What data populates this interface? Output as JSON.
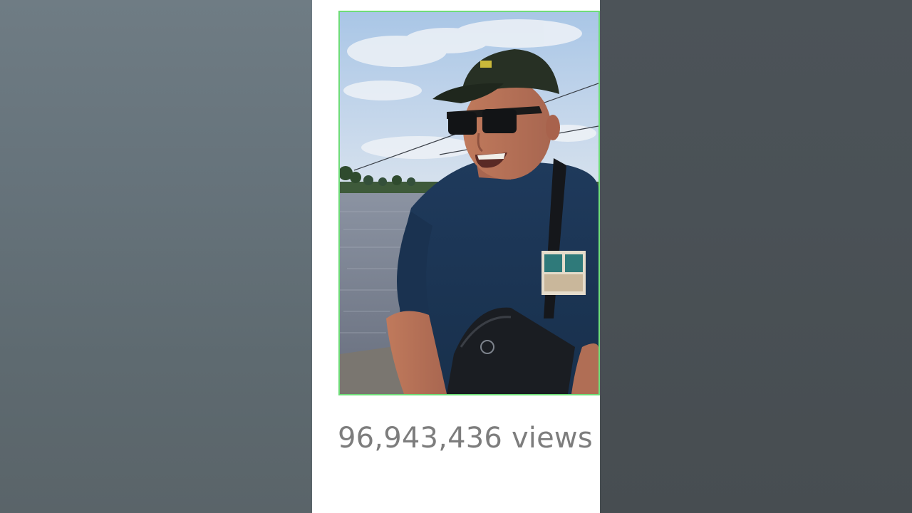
{
  "video": {
    "views_text": "96,943,436 views"
  }
}
